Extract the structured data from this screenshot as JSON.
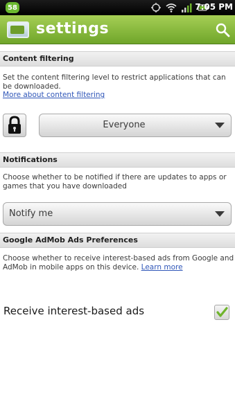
{
  "status_bar": {
    "badge": "58",
    "time": "7:05 PM",
    "icons": [
      "sync-icon",
      "wifi-icon",
      "signal-icon",
      "battery-icon"
    ]
  },
  "title_bar": {
    "title": "settings",
    "search_icon": "search-icon"
  },
  "content_filtering": {
    "header": "Content filtering",
    "description": "Set the content filtering level to restrict applications that can be downloaded.",
    "link": "More about content filtering",
    "lock_icon": "lock-icon",
    "selected": "Everyone"
  },
  "notifications": {
    "header": "Notifications",
    "description": "Choose whether to be notified if there are updates to apps or games that you have downloaded",
    "selected": "Notify me"
  },
  "admob": {
    "header": "Google AdMob Ads Preferences",
    "description": "Choose whether to receive interest-based ads from Google and AdMob in mobile apps on this device.",
    "link": "Learn more",
    "checkbox_label": "Receive interest-based ads",
    "checked": true
  },
  "colors": {
    "title_bar": "#7bb333",
    "link": "#2f56b8",
    "check": "#6fb42c"
  }
}
